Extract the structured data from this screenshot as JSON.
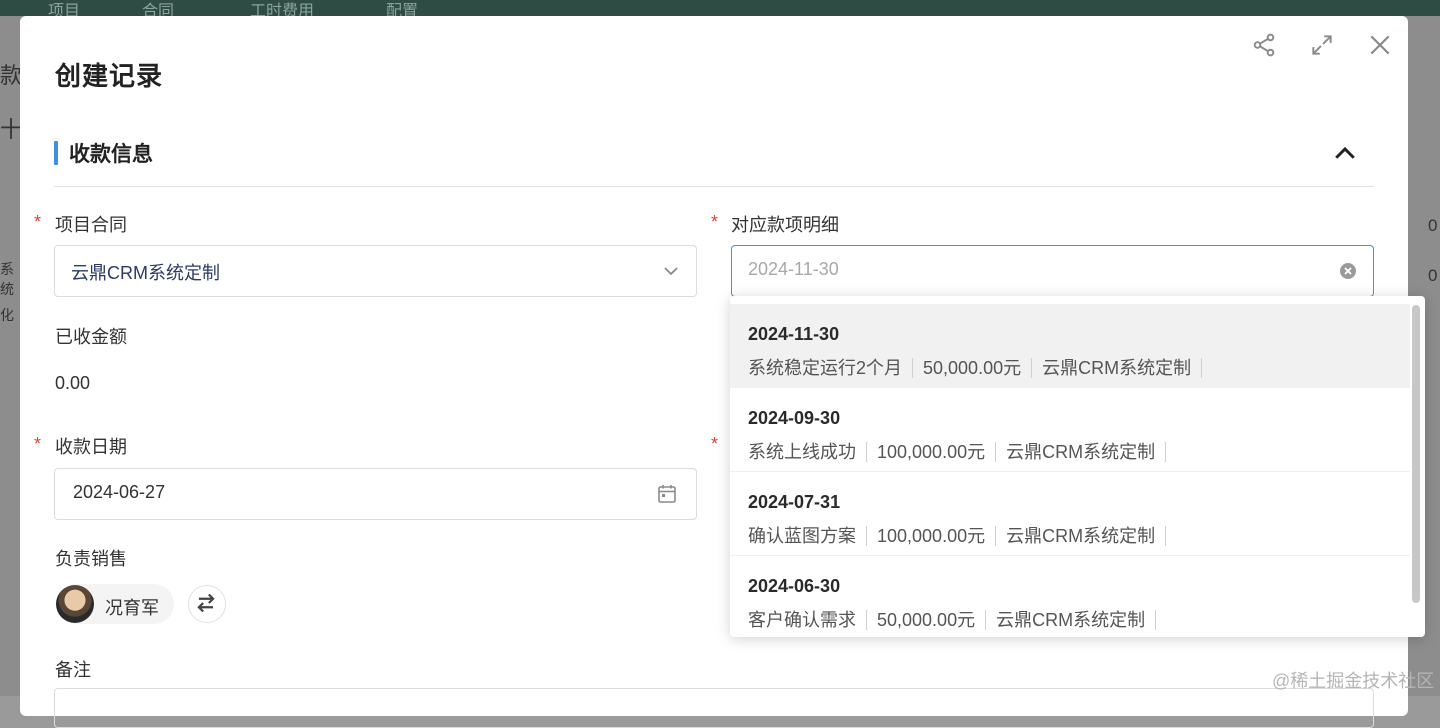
{
  "background": {
    "nav_items": [
      "项目",
      "合同",
      "工时费用",
      "配置"
    ],
    "left_fragments": [
      "款",
      "十",
      "系统",
      "化"
    ],
    "right_fragments": [
      "0",
      "0"
    ]
  },
  "modal": {
    "title": "创建记录",
    "header_icons": [
      "share-icon",
      "expand-icon",
      "close-icon"
    ],
    "section": {
      "title": "收款信息"
    },
    "fields": {
      "project_contract": {
        "label": "项目合同",
        "required": true,
        "value": "云鼎CRM系统定制"
      },
      "payment_detail": {
        "label": "对应款项明细",
        "required": true,
        "placeholder": "2024-11-30"
      },
      "received_amount": {
        "label": "已收金额",
        "value": "0.00"
      },
      "payment_date": {
        "label": "收款日期",
        "required": true,
        "value": "2024-06-27"
      },
      "sales": {
        "label": "负责销售",
        "name": "况育军"
      },
      "remark": {
        "label": "备注"
      }
    }
  },
  "dropdown": {
    "options": [
      {
        "date": "2024-11-30",
        "desc": "系统稳定运行2个月",
        "amount": "50,000.00元",
        "contract": "云鼎CRM系统定制"
      },
      {
        "date": "2024-09-30",
        "desc": "系统上线成功",
        "amount": "100,000.00元",
        "contract": "云鼎CRM系统定制"
      },
      {
        "date": "2024-07-31",
        "desc": "确认蓝图方案",
        "amount": "100,000.00元",
        "contract": "云鼎CRM系统定制"
      },
      {
        "date": "2024-06-30",
        "desc": "客户确认需求",
        "amount": "50,000.00元",
        "contract": "云鼎CRM系统定制"
      }
    ]
  },
  "watermark": "@稀土掘金技术社区",
  "colors": {
    "accent": "#3f8ee8",
    "required": "#e0443b",
    "contract_text": "#2b3a66"
  }
}
